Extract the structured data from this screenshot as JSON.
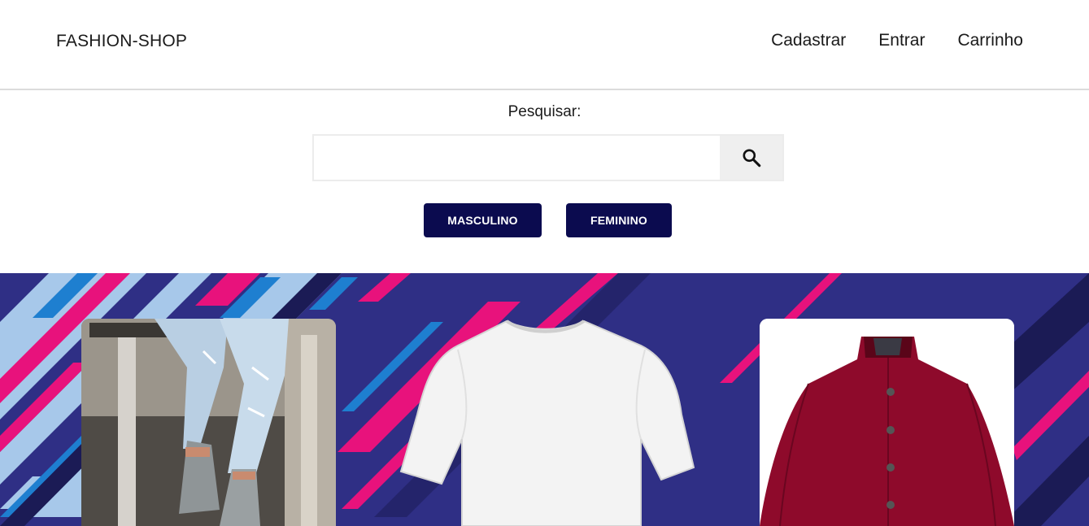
{
  "header": {
    "brand": "FASHION-SHOP",
    "nav": {
      "register": "Cadastrar",
      "login": "Entrar",
      "cart": "Carrinho"
    }
  },
  "search": {
    "label": "Pesquisar:",
    "value": "",
    "placeholder": "",
    "button_icon": "search-icon"
  },
  "categories": {
    "male": "MASCULINO",
    "female": "FEMININO"
  },
  "banner": {
    "products": [
      {
        "name": "ripped-jeans-sneakers-photo"
      },
      {
        "name": "white-tshirt"
      },
      {
        "name": "red-jacket"
      }
    ]
  },
  "colors": {
    "button_bg": "#0b0b4f",
    "banner_bg": "#2f2f85",
    "stripe_pink": "#e8127c",
    "stripe_light_blue": "#a7c8ea",
    "stripe_blue": "#1e7fd0",
    "stripe_dark": "#1b1b55"
  }
}
